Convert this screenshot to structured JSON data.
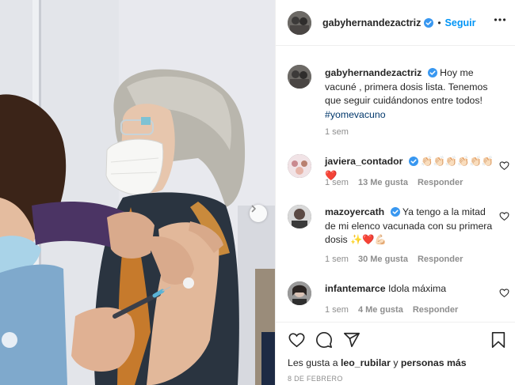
{
  "colors": {
    "accent_blue": "#0095f6",
    "hashtag_blue": "#00376b",
    "secondary_text": "#8e8e8e",
    "heart_red": "#c0152b"
  },
  "photo": {
    "alt": "Mujer mayor recibiendo vacuna",
    "next_icon": "chevron-right-icon"
  },
  "header": {
    "username": "gabyhernandezactriz",
    "separator": "•",
    "follow_label": "Seguir",
    "more_icon": "more-horizontal-icon"
  },
  "caption": {
    "username": "gabyhernandezactriz",
    "text": "Hoy me vacuné , primera dosis lista. Tenemos que seguir cuidándonos entre todos!",
    "hashtag": "#yomevacuno",
    "time": "1 sem"
  },
  "comments": [
    {
      "username": "javiera_contador",
      "text": "👏🏻👏🏻👏🏻👏🏻👏🏻👏🏻❤️",
      "time": "1 sem",
      "likes": "13 Me gusta",
      "reply": "Responder"
    },
    {
      "username": "mazoyercath",
      "text": "Ya tengo a la mitad de mi elenco vacunada con su primera dosis ✨❤️💪🏻",
      "time": "1 sem",
      "likes": "30 Me gusta",
      "reply": "Responder"
    },
    {
      "username": "infantemarce",
      "text": "Idola máxima",
      "time": "1 sem",
      "likes": "4 Me gusta",
      "reply": "Responder"
    }
  ],
  "footer": {
    "likes_prefix": "Les gusta a",
    "liked_by": "leo_rubilar",
    "conj": "y",
    "others": "personas más",
    "date": "8 DE FEBRERO"
  }
}
